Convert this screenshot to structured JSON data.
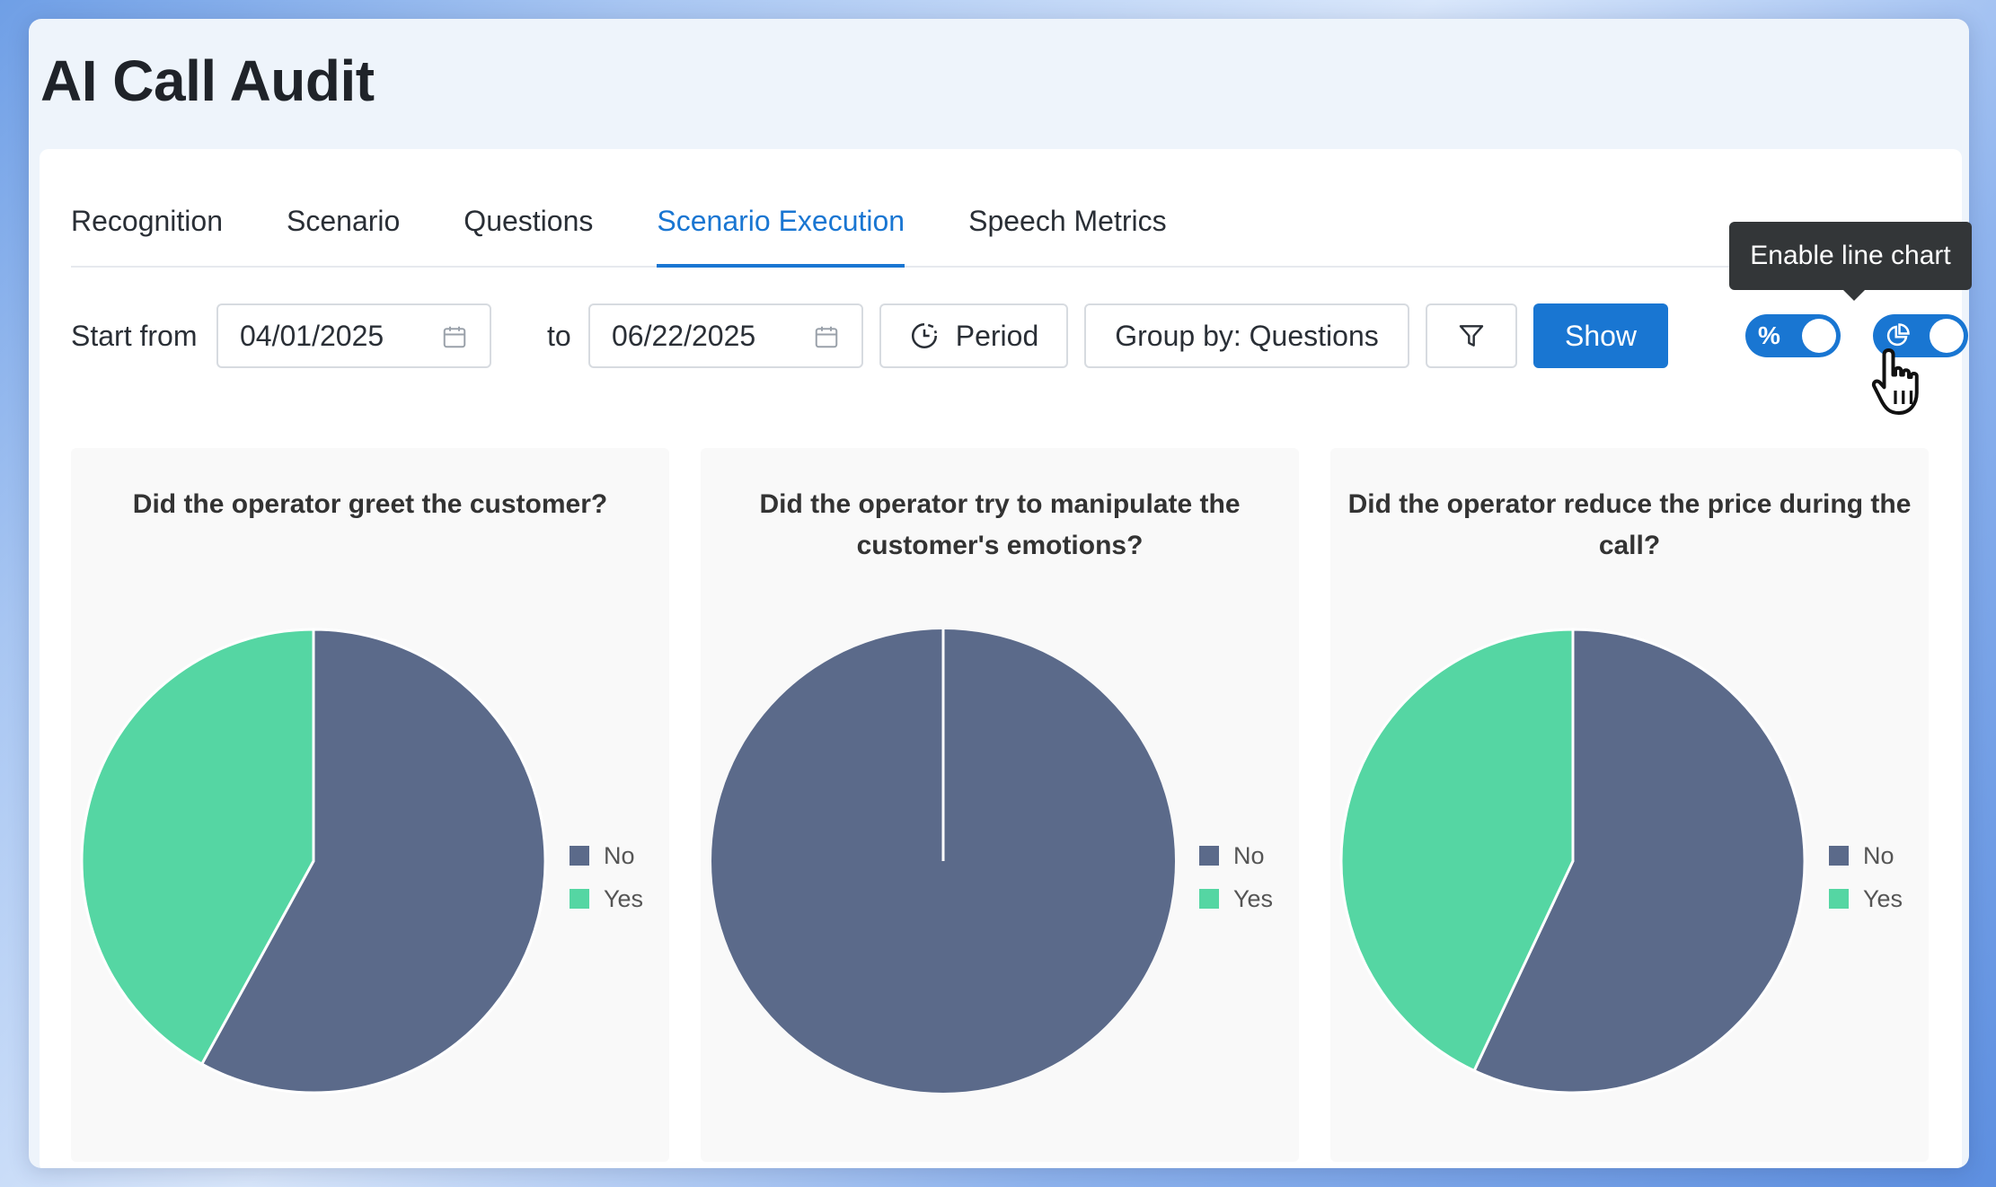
{
  "app": {
    "title": "AI Call Audit"
  },
  "tabs": [
    {
      "label": "Recognition",
      "active": false
    },
    {
      "label": "Scenario",
      "active": false
    },
    {
      "label": "Questions",
      "active": false
    },
    {
      "label": "Scenario Execution",
      "active": true
    },
    {
      "label": "Speech Metrics",
      "active": false
    }
  ],
  "filters": {
    "start_label": "Start from",
    "start_date": "04/01/2025",
    "to_label": "to",
    "end_date": "06/22/2025",
    "period_label": "Period",
    "group_by_label": "Group by: Questions",
    "show_label": "Show"
  },
  "toggles": {
    "percent": {
      "glyph": "%",
      "on": true
    },
    "chart_type": {
      "icon": "pie-chart-icon",
      "on": true
    }
  },
  "tooltip": {
    "text": "Enable line chart"
  },
  "colors": {
    "accent": "#1976d2",
    "no": "#5b6a8a",
    "yes": "#55d6a3"
  },
  "chart_data": [
    {
      "type": "pie",
      "title": "Did the operator greet the customer?",
      "categories": [
        "No",
        "Yes"
      ],
      "values": [
        58,
        42
      ],
      "legend": "right"
    },
    {
      "type": "pie",
      "title": "Did the operator try to manipulate the customer's emotions?",
      "categories": [
        "No",
        "Yes"
      ],
      "values": [
        100,
        0
      ],
      "legend": "right"
    },
    {
      "type": "pie",
      "title": "Did the operator reduce the price during the call?",
      "categories": [
        "No",
        "Yes"
      ],
      "values": [
        57,
        43
      ],
      "legend": "right"
    }
  ]
}
